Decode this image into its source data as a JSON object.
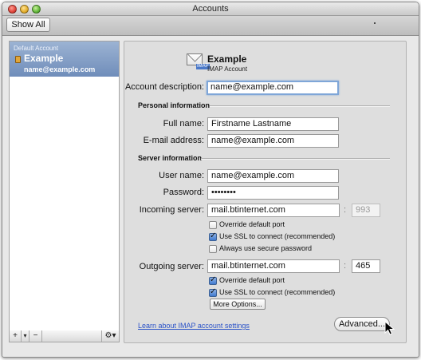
{
  "window": {
    "title": "Accounts"
  },
  "toolbar": {
    "show_all_label": "Show All"
  },
  "sidebar": {
    "group_label": "Default Account",
    "account_name": "Example",
    "account_email": "name@example.com",
    "add_label": "+",
    "add_menu_label": "▾",
    "remove_label": "−",
    "action_label": "⚙▾"
  },
  "header": {
    "name": "Example",
    "type": "IMAP Account",
    "icon_tag": "IMAP"
  },
  "form": {
    "account_description": {
      "label": "Account description:",
      "value": "name@example.com"
    },
    "personal_section": "Personal information",
    "full_name": {
      "label": "Full name:",
      "value": "Firstname Lastname"
    },
    "email": {
      "label": "E-mail address:",
      "value": "name@example.com"
    },
    "server_section": "Server information",
    "user_name": {
      "label": "User name:",
      "value": "name@example.com"
    },
    "password": {
      "label": "Password:",
      "value": "••••••••"
    },
    "incoming": {
      "label": "Incoming server:",
      "value": "mail.btinternet.com",
      "port": "993"
    },
    "incoming_options": [
      {
        "label": "Override default port",
        "checked": false
      },
      {
        "label": "Use SSL to connect (recommended)",
        "checked": true
      },
      {
        "label": "Always use secure password",
        "checked": false
      }
    ],
    "outgoing": {
      "label": "Outgoing server:",
      "value": "mail.btinternet.com",
      "port": "465"
    },
    "outgoing_options": [
      {
        "label": "Override default port",
        "checked": true
      },
      {
        "label": "Use SSL to connect (recommended)",
        "checked": true
      }
    ],
    "more_options_label": "More Options...",
    "learn_link": "Learn about IMAP account settings",
    "advanced_label": "Advanced..."
  }
}
